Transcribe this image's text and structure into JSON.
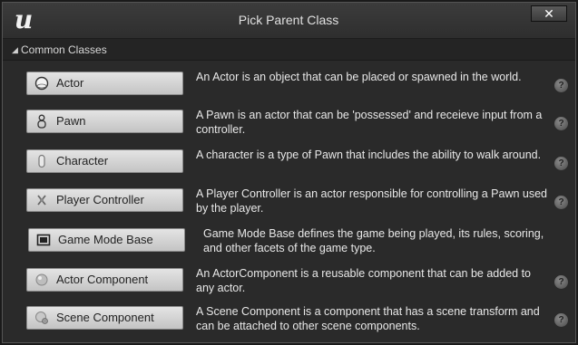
{
  "window": {
    "title": "Pick Parent Class",
    "close_label": "✕"
  },
  "section": {
    "label": "Common Classes",
    "expand_icon": "triangle-down-icon"
  },
  "classes": [
    {
      "label": "Actor",
      "icon": "sphere-icon",
      "description": "An Actor is an object that can be placed or spawned in the world."
    },
    {
      "label": "Pawn",
      "icon": "pawn-figure-icon",
      "description": "A Pawn is an actor that can be 'possessed' and receieve input from a controller."
    },
    {
      "label": "Character",
      "icon": "capsule-icon",
      "description": "A character is a type of Pawn that includes the ability to walk around."
    },
    {
      "label": "Player Controller",
      "icon": "controller-icon",
      "description": "A Player Controller is an actor responsible for controlling a Pawn used by the player."
    },
    {
      "label": "Game Mode Base",
      "icon": "game-mode-icon",
      "description": "Game Mode Base defines the game being played, its rules, scoring, and other facets of the game type."
    },
    {
      "label": "Actor Component",
      "icon": "component-icon",
      "description": "An ActorComponent is a reusable component that can be added to any actor."
    },
    {
      "label": "Scene Component",
      "icon": "scene-component-icon",
      "description": "A Scene Component is a component that has a scene transform and can be attached to other scene components."
    }
  ],
  "help_icon": "question-circle-icon",
  "colors": {
    "window_bg": "#2a2a2a",
    "titlebar_bg": "#353535",
    "button_bg": "#d4d4d4",
    "text": "#e6e6e6"
  }
}
